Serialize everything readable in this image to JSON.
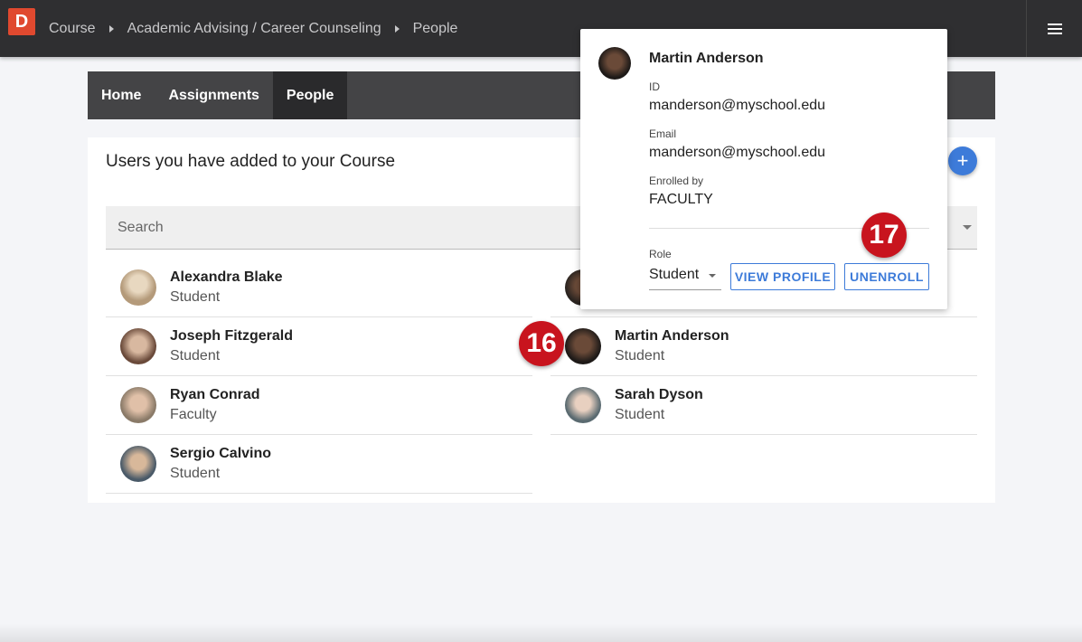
{
  "app": {
    "logo_letter": "D",
    "breadcrumbs": [
      "Course",
      "Academic Advising / Career Counseling",
      "People"
    ]
  },
  "tabs": [
    {
      "label": "Home",
      "active": false
    },
    {
      "label": "Assignments",
      "active": false
    },
    {
      "label": "People",
      "active": true
    }
  ],
  "main": {
    "title": "Users you have added to your Course",
    "add_icon": "+",
    "search_placeholder": "Search"
  },
  "people": [
    {
      "name": "Alexandra Blake",
      "role": "Student",
      "avatar_color": "#b49a7a"
    },
    {
      "name": "Joseph Fitzgerald",
      "role": "Student",
      "avatar_color": "#7a5a4a"
    },
    {
      "name": "Martin Anderson",
      "role": "Student",
      "avatar_color": "#2e2a28"
    },
    {
      "name": "Ryan Conrad",
      "role": "Faculty",
      "avatar_color": "#a08870"
    },
    {
      "name": "Sarah Dyson",
      "role": "Student",
      "avatar_color": "#8a9aa0"
    },
    {
      "name": "Sergio Calvino",
      "role": "Student",
      "avatar_color": "#5a6a78"
    }
  ],
  "popup": {
    "name": "Martin Anderson",
    "id_label": "ID",
    "id_value": "manderson@myschool.edu",
    "email_label": "Email",
    "email_value": "manderson@myschool.edu",
    "enrolled_label": "Enrolled by",
    "enrolled_value": "FACULTY",
    "role_label": "Role",
    "role_value": "Student",
    "view_profile": "VIEW PROFILE",
    "unenroll": "UNENROLL"
  },
  "badges": {
    "step16": "16",
    "step17": "17"
  },
  "colors": {
    "accent": "#3d7bd9",
    "badge": "#c8141e",
    "logo": "#e0492f",
    "topbar": "#2f2f31"
  }
}
